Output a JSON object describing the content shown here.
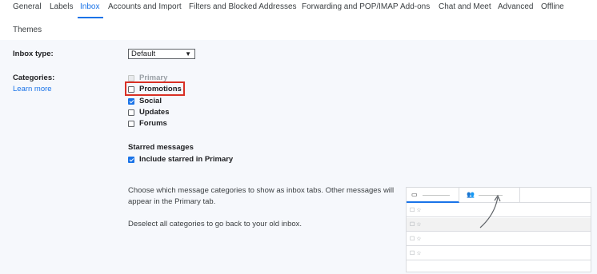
{
  "tabs": [
    {
      "label": "General"
    },
    {
      "label": "Labels"
    },
    {
      "label": "Inbox",
      "active": true
    },
    {
      "label": "Accounts and Import"
    },
    {
      "label": "Filters and Blocked Addresses"
    },
    {
      "label": "Forwarding and POP/IMAP"
    },
    {
      "label": "Add-ons"
    },
    {
      "label": "Chat and Meet"
    },
    {
      "label": "Advanced"
    },
    {
      "label": "Offline"
    },
    {
      "label": "Themes"
    }
  ],
  "inbox_type": {
    "label": "Inbox type:",
    "selected": "Default"
  },
  "categories": {
    "label": "Categories:",
    "learn_more": "Learn more",
    "items": [
      {
        "label": "Primary",
        "checked": false,
        "disabled": true
      },
      {
        "label": "Promotions",
        "checked": false,
        "highlighted": true
      },
      {
        "label": "Social",
        "checked": true
      },
      {
        "label": "Updates",
        "checked": false
      },
      {
        "label": "Forums",
        "checked": false
      }
    ]
  },
  "starred": {
    "heading": "Starred messages",
    "option": "Include starred in Primary",
    "checked": true
  },
  "description": {
    "line1": "Choose which message categories to show as inbox tabs. Other messages will",
    "line2": "appear in the Primary tab.",
    "deselect": "Deselect all categories to go back to your old inbox."
  },
  "preview": {
    "row_glyphs": "☐ ☆"
  },
  "colors": {
    "accent": "#1a73e8",
    "highlight": "#d93025",
    "panel_bg": "#f6f8fc"
  }
}
